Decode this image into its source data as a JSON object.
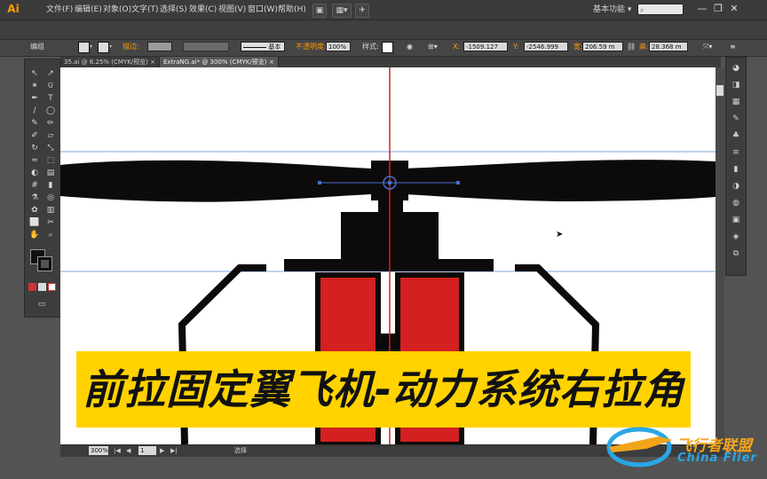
{
  "app": {
    "logo": "Ai"
  },
  "menu": [
    "文件(F)",
    "编辑(E)",
    "对象(O)",
    "文字(T)",
    "选择(S)",
    "效果(C)",
    "视图(V)",
    "窗口(W)",
    "帮助(H)"
  ],
  "workspace": {
    "label": "基本功能 ▾",
    "search_placeholder": ""
  },
  "window_controls": {
    "minimize": "—",
    "restore": "❐",
    "close": "✕"
  },
  "control_bar": {
    "selection_label": "编组",
    "stroke_label": "描边:",
    "stroke_style": "基本",
    "opacity_label": "不透明度:",
    "opacity_value": "100%",
    "style_label": "样式:",
    "x_label": "X:",
    "x_value": "-1509.127",
    "y_label": "Y:",
    "y_value": "-2546.999",
    "w_label": "宽:",
    "w_value": "206.59 m",
    "h_label": "高:",
    "h_value": "28.368 m"
  },
  "tabs": [
    {
      "label": "35.ai @ 6.25% (CMYK/预览)",
      "close": "×",
      "active": false
    },
    {
      "label": "ExtraNG.ai* @ 300% (CMYK/预览)",
      "close": "×",
      "active": true
    }
  ],
  "status_bar": {
    "zoom": "300%",
    "page": "1",
    "selection_tool": "选择"
  },
  "caption": {
    "text": "前拉固定翼飞机-动力系统右拉角"
  },
  "watermark": {
    "cn": "飞行者联盟",
    "en": "China Flier"
  },
  "colors": {
    "ai_orange": "#ff9a00",
    "caption_yellow": "#ffd200",
    "motor_red": "#d42020",
    "guide_blue": "#4a7cd4"
  },
  "icons": {
    "tools": [
      "selection-arrow-icon",
      "direct-selection-icon",
      "magic-wand-icon",
      "lasso-icon",
      "pen-icon",
      "type-icon",
      "line-icon",
      "ellipse-icon",
      "brush-icon",
      "pencil-icon",
      "blob-brush-icon",
      "eraser-icon",
      "rotate-icon",
      "scale-icon",
      "warp-icon",
      "free-transform-icon",
      "shape-builder-icon",
      "perspective-icon",
      "mesh-icon",
      "gradient-icon",
      "eyedropper-icon",
      "blend-icon",
      "symbol-sprayer-icon",
      "graph-icon",
      "artboard-icon",
      "slice-icon",
      "hand-icon",
      "zoom-icon"
    ],
    "dock": [
      "color-icon",
      "color-guide-icon",
      "swatches-icon",
      "brushes-icon",
      "symbols-icon",
      "stroke-icon",
      "gradient-panel-icon",
      "transparency-icon",
      "appearance-icon",
      "graphic-styles-icon",
      "layers-icon",
      "artboards-icon"
    ]
  }
}
